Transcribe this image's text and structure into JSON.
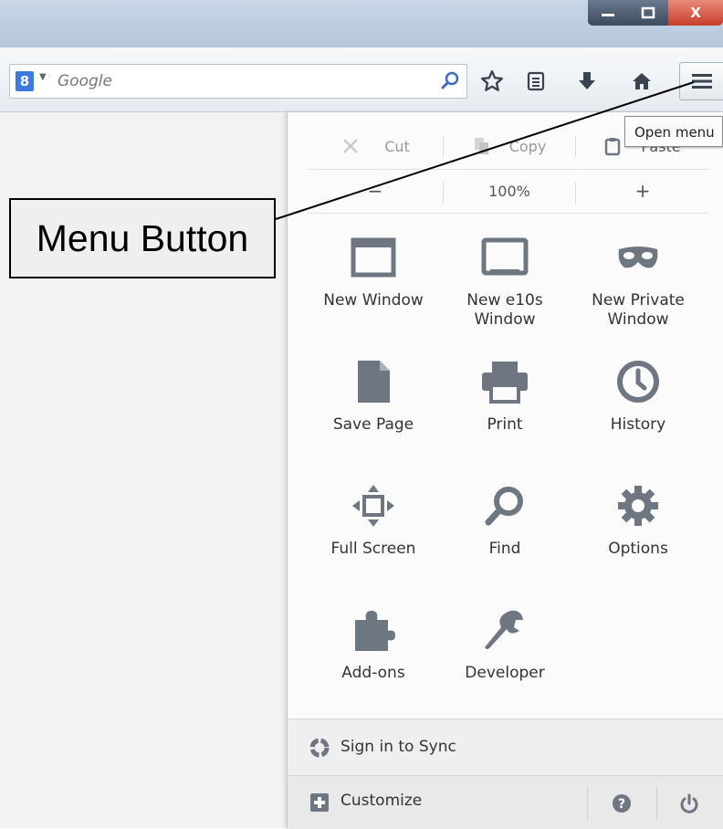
{
  "window": {
    "close_glyph": "X"
  },
  "search": {
    "engine_logo": "8",
    "placeholder": "Google"
  },
  "tooltip": {
    "text": "Open menu"
  },
  "edit": {
    "cut": "Cut",
    "copy": "Copy",
    "paste": "Paste"
  },
  "zoom": {
    "minus": "−",
    "level": "100%",
    "plus": "+"
  },
  "menu_items": [
    {
      "label": "New Window",
      "icon": "window-icon"
    },
    {
      "label": "New e10s\nWindow",
      "icon": "monitor-icon"
    },
    {
      "label": "New Private\nWindow",
      "icon": "mask-icon"
    },
    {
      "label": "Save Page",
      "icon": "page-icon"
    },
    {
      "label": "Print",
      "icon": "printer-icon"
    },
    {
      "label": "History",
      "icon": "clock-icon"
    },
    {
      "label": "Full Screen",
      "icon": "fullscreen-arrows-icon"
    },
    {
      "label": "Find",
      "icon": "magnifier-icon"
    },
    {
      "label": "Options",
      "icon": "gear-icon"
    },
    {
      "label": "Add-ons",
      "icon": "puzzle-icon"
    },
    {
      "label": "Developer",
      "icon": "wrench-icon"
    }
  ],
  "footer": {
    "sync_label": "Sign in to Sync",
    "customize_label": "Customize"
  },
  "annotation": {
    "callout_text": "Menu Button"
  },
  "colors": {
    "icon_gray": "#6e7682",
    "accent_blue": "#3b7be0"
  }
}
